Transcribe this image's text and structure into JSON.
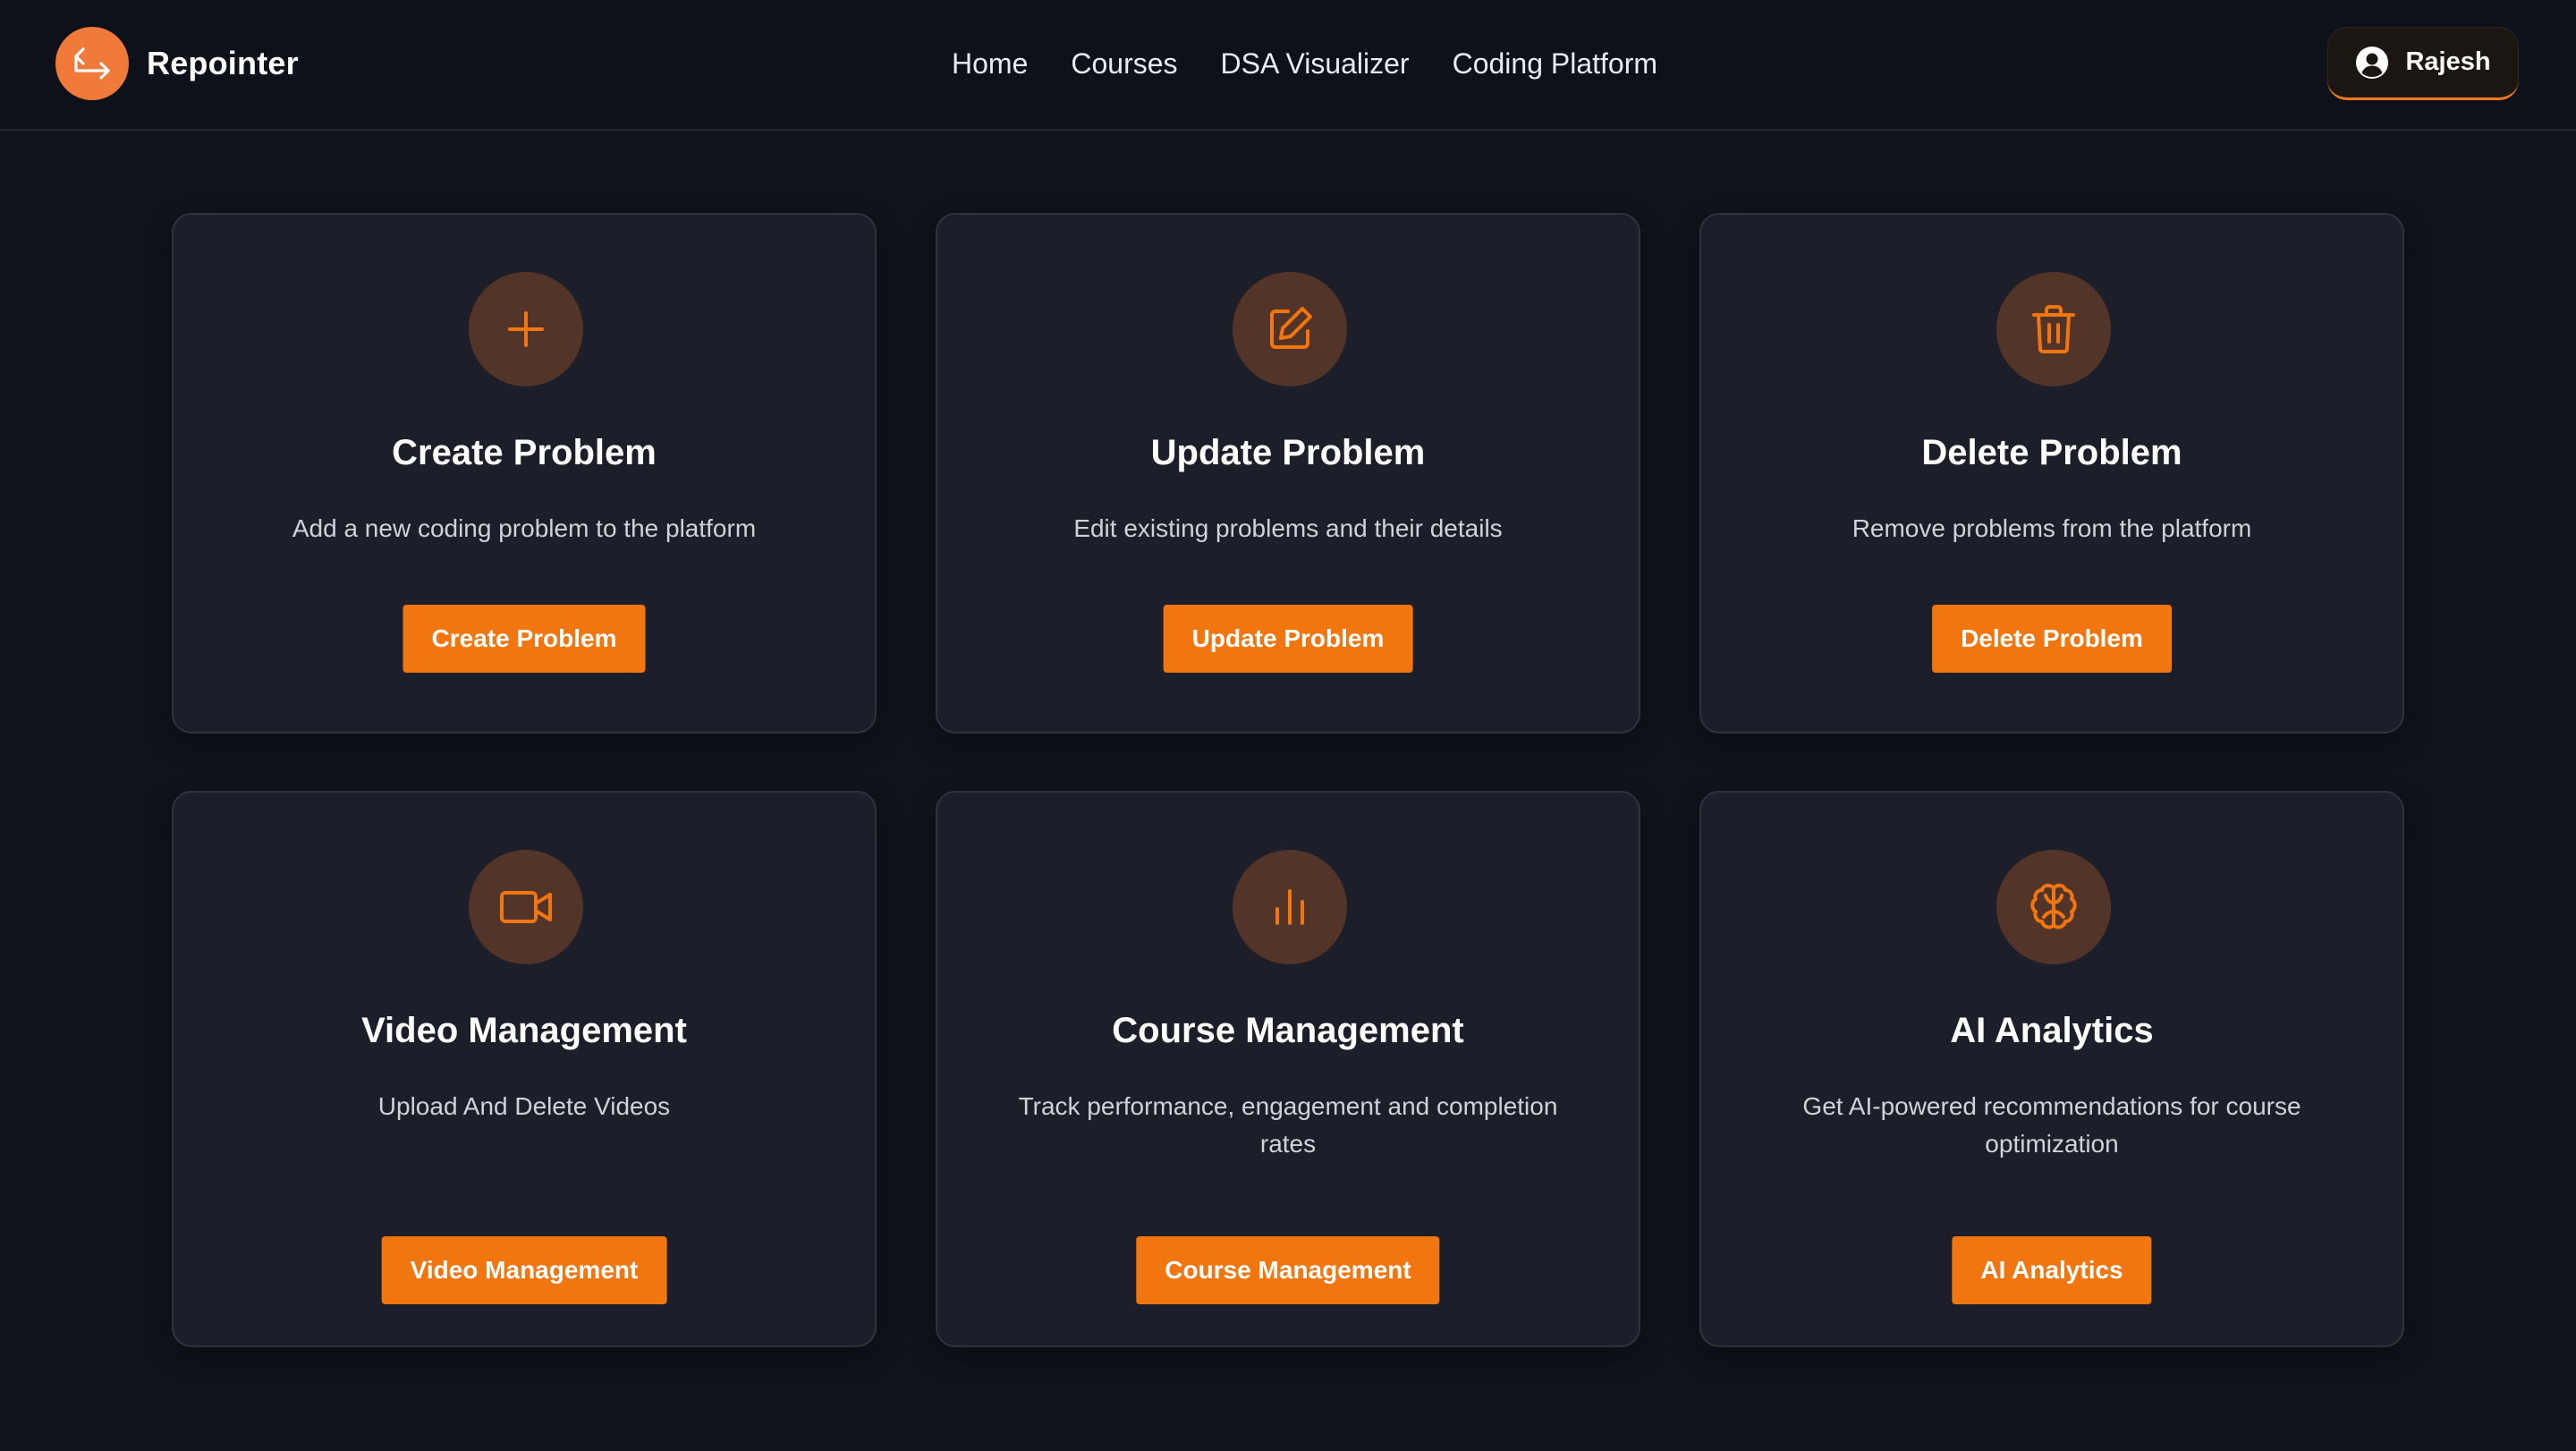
{
  "app": {
    "name": "Repointer"
  },
  "nav": {
    "items": [
      {
        "label": "Home"
      },
      {
        "label": "Courses"
      },
      {
        "label": "DSA Visualizer"
      },
      {
        "label": "Coding Platform"
      }
    ]
  },
  "user": {
    "name": "Rajesh",
    "icon": "user-circle-icon"
  },
  "theme": {
    "accent": "#f2760f",
    "background": "#10131c",
    "card": "#1c1f29",
    "icon_circle": "#523428"
  },
  "cards": [
    {
      "icon": "plus-icon",
      "title": "Create Problem",
      "description": "Add a new coding problem to the platform",
      "button": "Create Problem"
    },
    {
      "icon": "edit-icon",
      "title": "Update Problem",
      "description": "Edit existing problems and their details",
      "button": "Update Problem"
    },
    {
      "icon": "trash-icon",
      "title": "Delete Problem",
      "description": "Remove problems from the platform",
      "button": "Delete Problem"
    },
    {
      "icon": "video-icon",
      "title": "Video Management",
      "description": "Upload And Delete Videos",
      "button": "Video Management"
    },
    {
      "icon": "bar-chart-icon",
      "title": "Course Management",
      "description": "Track performance, engagement and completion rates",
      "button": "Course Management"
    },
    {
      "icon": "brain-icon",
      "title": "AI Analytics",
      "description": "Get AI-powered recommendations for course optimization",
      "button": "AI Analytics"
    }
  ]
}
